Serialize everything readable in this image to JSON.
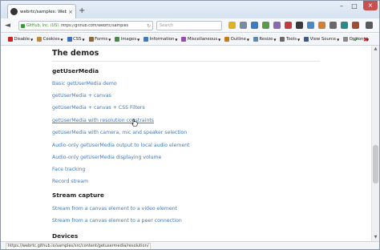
{
  "browser": {
    "tab_title": "webrtc/samples: WebRTC ...",
    "tab_close": "×",
    "new_tab": "+",
    "window_controls": {
      "minimize": "–",
      "maximize": "□",
      "close": "×"
    },
    "nav": {
      "back": "◄",
      "reload": "↻"
    },
    "url_site": "GitHub, Inc. (US)",
    "url": "https://github.com/webrtc/samples",
    "search_placeholder": "Search",
    "status_url": "https://webrtc.github.io/samples/src/content/getusermedia/resolution/"
  },
  "devtoolbar": {
    "items": [
      {
        "label": "Disable",
        "color": "#cc2222"
      },
      {
        "label": "Cookies",
        "color": "#c08a3a"
      },
      {
        "label": "CSS",
        "color": "#3a6ec8"
      },
      {
        "label": "Forms",
        "color": "#8a6a3a"
      },
      {
        "label": "Images",
        "color": "#4a8a4a"
      },
      {
        "label": "Information",
        "color": "#3a7ac8"
      },
      {
        "label": "Miscellaneous",
        "color": "#9a4ab0"
      },
      {
        "label": "Outline",
        "color": "#c87a1a"
      },
      {
        "label": "Resize",
        "color": "#5a8ab0"
      },
      {
        "label": "Tools",
        "color": "#6a6a6a"
      },
      {
        "label": "View Source",
        "color": "#3a5a8a"
      },
      {
        "label": "Options",
        "color": "#8a8a8a"
      }
    ],
    "status_ok": "✔",
    "status_error": "✖"
  },
  "page": {
    "heading": "The demos",
    "sections": [
      {
        "title": "getUserMedia",
        "links": [
          "Basic getUserMedia demo",
          "getUserMedia + canvas",
          "getUserMedia + canvas + CSS Filters",
          "getUserMedia with resolution constraints",
          "getUserMedia with camera, mic and speaker selection",
          "Audio-only getUserMedia output to local audio element",
          "Audio-only getUserMedia displaying volume",
          "Face tracking",
          "Record stream"
        ]
      },
      {
        "title": "Stream capture",
        "links": [
          "Stream from a canvas element to a video element",
          "Stream from a canvas element to a peer connection"
        ]
      },
      {
        "title": "Devices",
        "links": []
      }
    ]
  }
}
